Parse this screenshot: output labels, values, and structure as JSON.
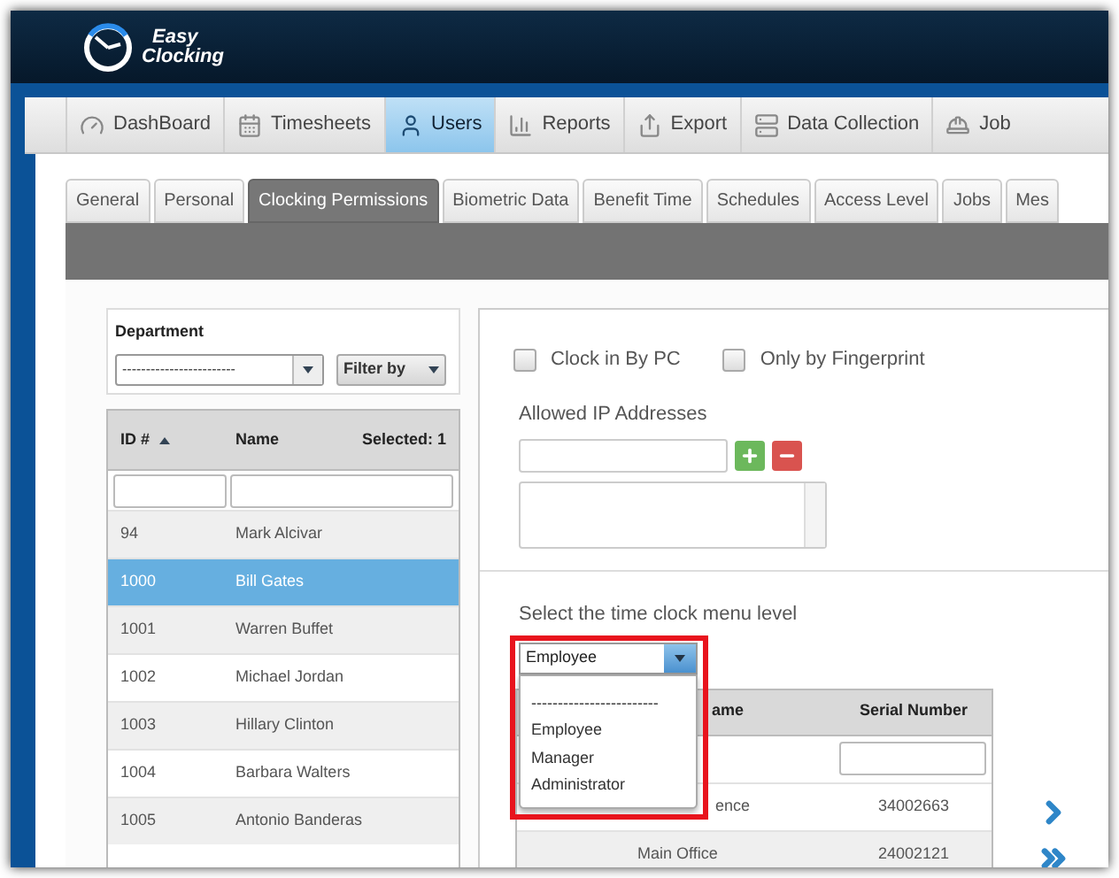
{
  "logo": {
    "line_1": "Easy",
    "line_2": "Clocking"
  },
  "main_nav": [
    {
      "label": "DashBoard",
      "selected": false
    },
    {
      "label": "Timesheets",
      "selected": false
    },
    {
      "label": "Users",
      "selected": true
    },
    {
      "label": "Reports",
      "selected": false
    },
    {
      "label": "Export",
      "selected": false
    },
    {
      "label": "Data Collection",
      "selected": false
    },
    {
      "label": "Job",
      "selected": false
    }
  ],
  "sub_tabs": [
    {
      "label": "General",
      "selected": false
    },
    {
      "label": "Personal",
      "selected": false
    },
    {
      "label": "Clocking Permissions",
      "selected": true
    },
    {
      "label": "Biometric Data",
      "selected": false
    },
    {
      "label": "Benefit Time",
      "selected": false
    },
    {
      "label": "Schedules",
      "selected": false
    },
    {
      "label": "Access Level",
      "selected": false
    },
    {
      "label": "Jobs",
      "selected": false
    },
    {
      "label": "Mes",
      "selected": false
    }
  ],
  "department": {
    "label": "Department",
    "value": "------------------------",
    "filter_label": "Filter by"
  },
  "users_table": {
    "columns": [
      "ID #",
      "Name"
    ],
    "selected_count": "Selected: 1",
    "rows": [
      {
        "id": "94",
        "name": "Mark Alcivar",
        "selected": false
      },
      {
        "id": "1000",
        "name": "Bill Gates",
        "selected": true
      },
      {
        "id": "1001",
        "name": "Warren Buffet",
        "selected": false
      },
      {
        "id": "1002",
        "name": "Michael Jordan",
        "selected": false
      },
      {
        "id": "1003",
        "name": "Hillary Clinton",
        "selected": false
      },
      {
        "id": "1004",
        "name": "Barbara Walters",
        "selected": false
      },
      {
        "id": "1005",
        "name": "Antonio Banderas",
        "selected": false
      }
    ]
  },
  "permissions": {
    "checkboxes": [
      {
        "label": "Clock in By PC",
        "checked": false
      },
      {
        "label": "Only by Fingerprint",
        "checked": false
      }
    ],
    "ip_label": "Allowed IP Addresses",
    "menu_level": {
      "label": "Select the time clock menu level",
      "value": "Employee",
      "expanded": true,
      "highlighted": true,
      "options": [
        "------------------------",
        "Employee",
        "Manager",
        "Administrator"
      ]
    },
    "devices_table": {
      "columns": [
        "ame",
        "Serial Number"
      ],
      "rows": [
        {
          "name": "ence",
          "serial": "34002663"
        },
        {
          "name": "Main Office",
          "serial": "24002121"
        }
      ]
    }
  }
}
